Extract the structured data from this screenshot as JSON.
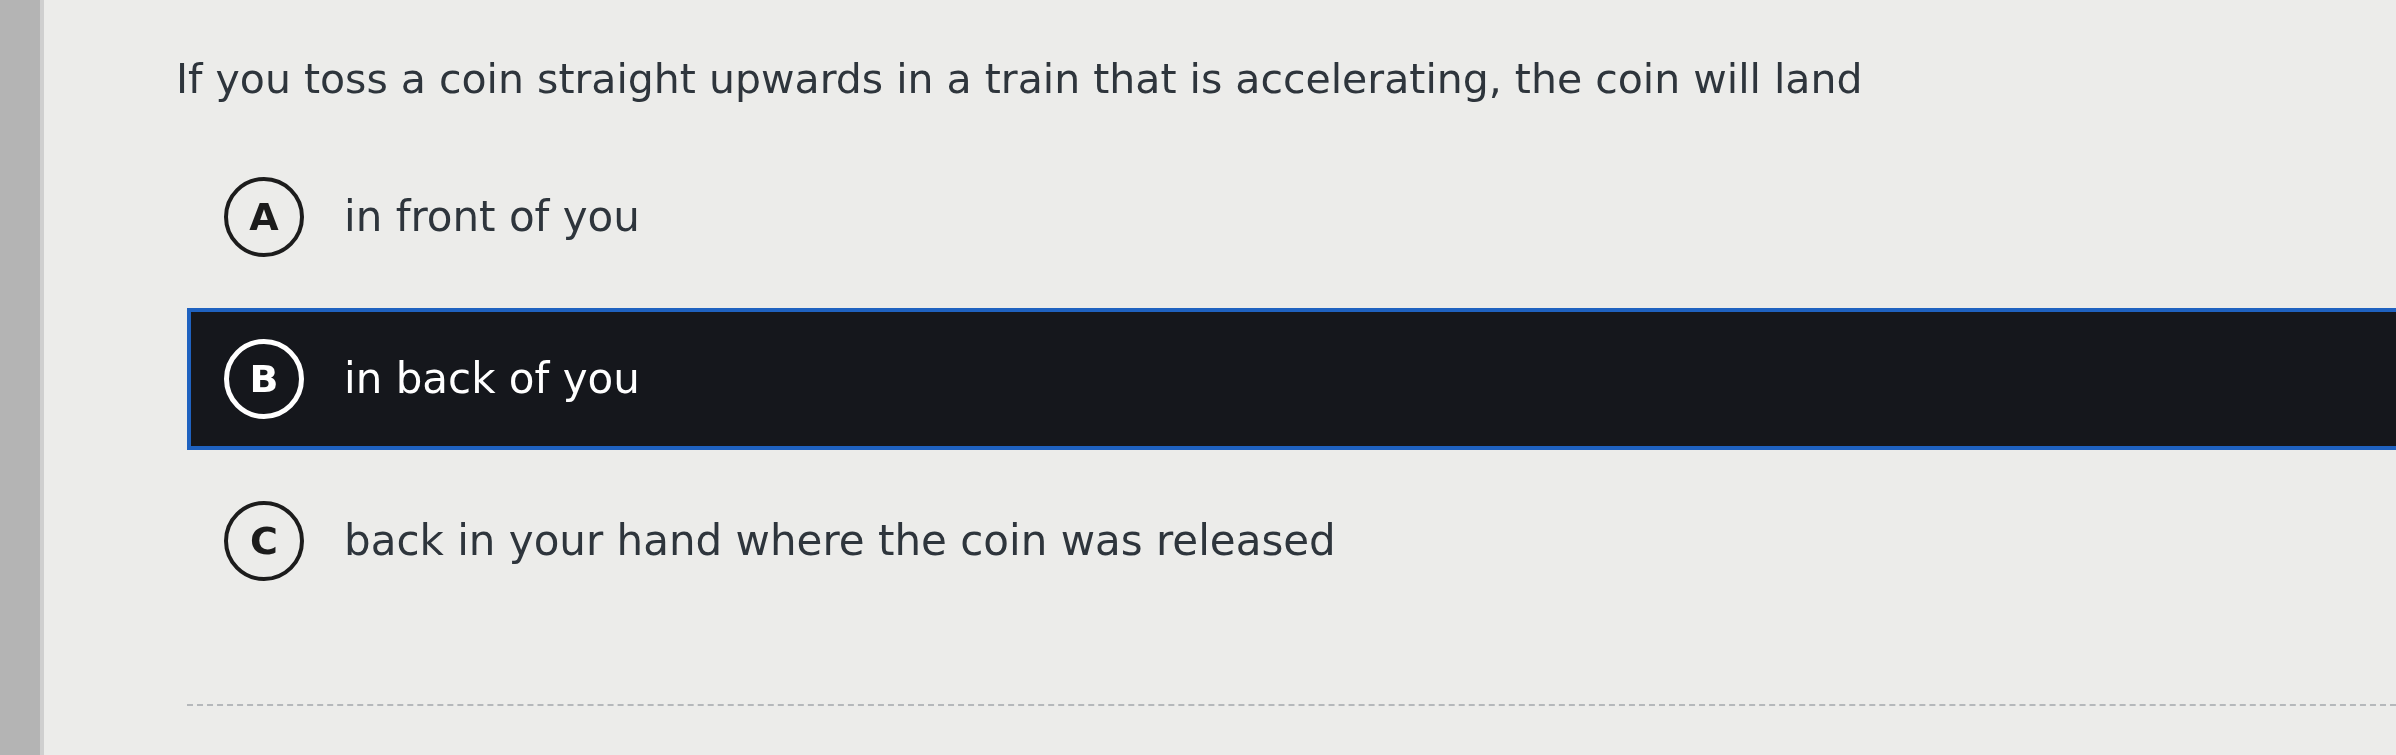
{
  "question": {
    "text": "If you toss a coin straight upwards in a train that is accelerating, the coin will land"
  },
  "options": [
    {
      "letter": "A",
      "text": "in front of you",
      "selected": false
    },
    {
      "letter": "B",
      "text": "in back of you",
      "selected": true
    },
    {
      "letter": "C",
      "text": "back in your hand where the coin was released",
      "selected": false
    }
  ]
}
